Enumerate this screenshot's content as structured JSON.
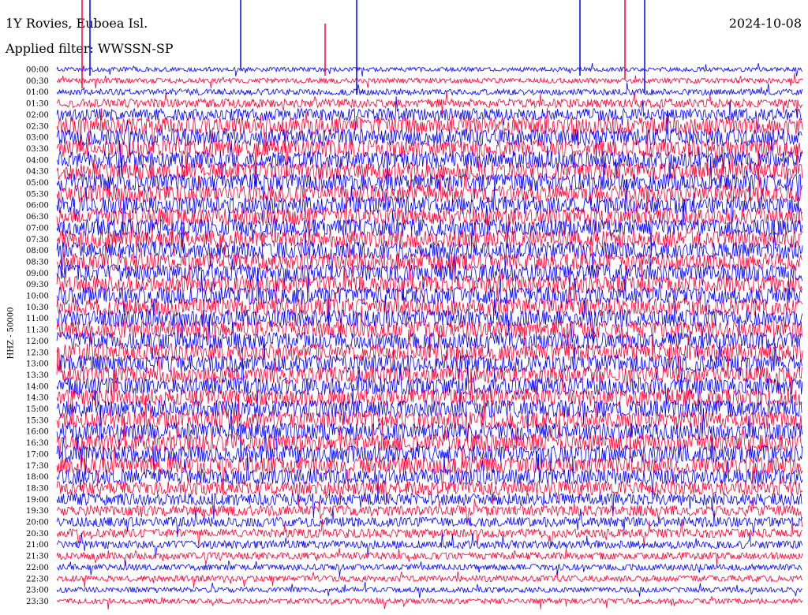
{
  "header": {
    "station": "1Y Rovies, Euboea Isl.",
    "filter": "Applied filter: WWSSN-SP",
    "date": "2024-10-08"
  },
  "chart_data": {
    "type": "line",
    "title": "1Y Rovies, Euboea Isl.",
    "subtitle": "Applied filter: WWSSN-SP",
    "ylabel": "HHZ - 50000",
    "xlabel": "",
    "colors": [
      "#0000ff",
      "#ff0033"
    ],
    "rows": [
      "00:00",
      "00:30",
      "01:00",
      "01:30",
      "02:00",
      "02:30",
      "03:00",
      "03:30",
      "04:00",
      "04:30",
      "05:00",
      "05:30",
      "06:00",
      "06:30",
      "07:00",
      "07:30",
      "08:00",
      "08:30",
      "09:00",
      "09:30",
      "10:00",
      "10:30",
      "11:00",
      "11:30",
      "12:00",
      "12:30",
      "13:00",
      "13:30",
      "14:00",
      "14:30",
      "15:00",
      "15:30",
      "16:00",
      "16:30",
      "17:00",
      "17:30",
      "18:00",
      "18:30",
      "19:00",
      "19:30",
      "20:00",
      "20:30",
      "21:00",
      "21:30",
      "22:00",
      "22:30",
      "23:00",
      "23:30"
    ],
    "amplitude": [
      0.25,
      0.3,
      0.35,
      0.5,
      0.7,
      1.0,
      1.0,
      1.0,
      1.0,
      1.0,
      1.0,
      1.0,
      1.0,
      1.0,
      1.0,
      1.0,
      1.0,
      1.0,
      1.0,
      1.0,
      1.0,
      1.0,
      1.0,
      1.0,
      1.0,
      1.0,
      1.0,
      1.0,
      1.0,
      1.0,
      1.0,
      1.0,
      1.0,
      1.0,
      1.0,
      1.0,
      0.9,
      0.8,
      0.7,
      0.6,
      0.55,
      0.5,
      0.45,
      0.4,
      0.35,
      0.35,
      0.3,
      0.3
    ]
  }
}
